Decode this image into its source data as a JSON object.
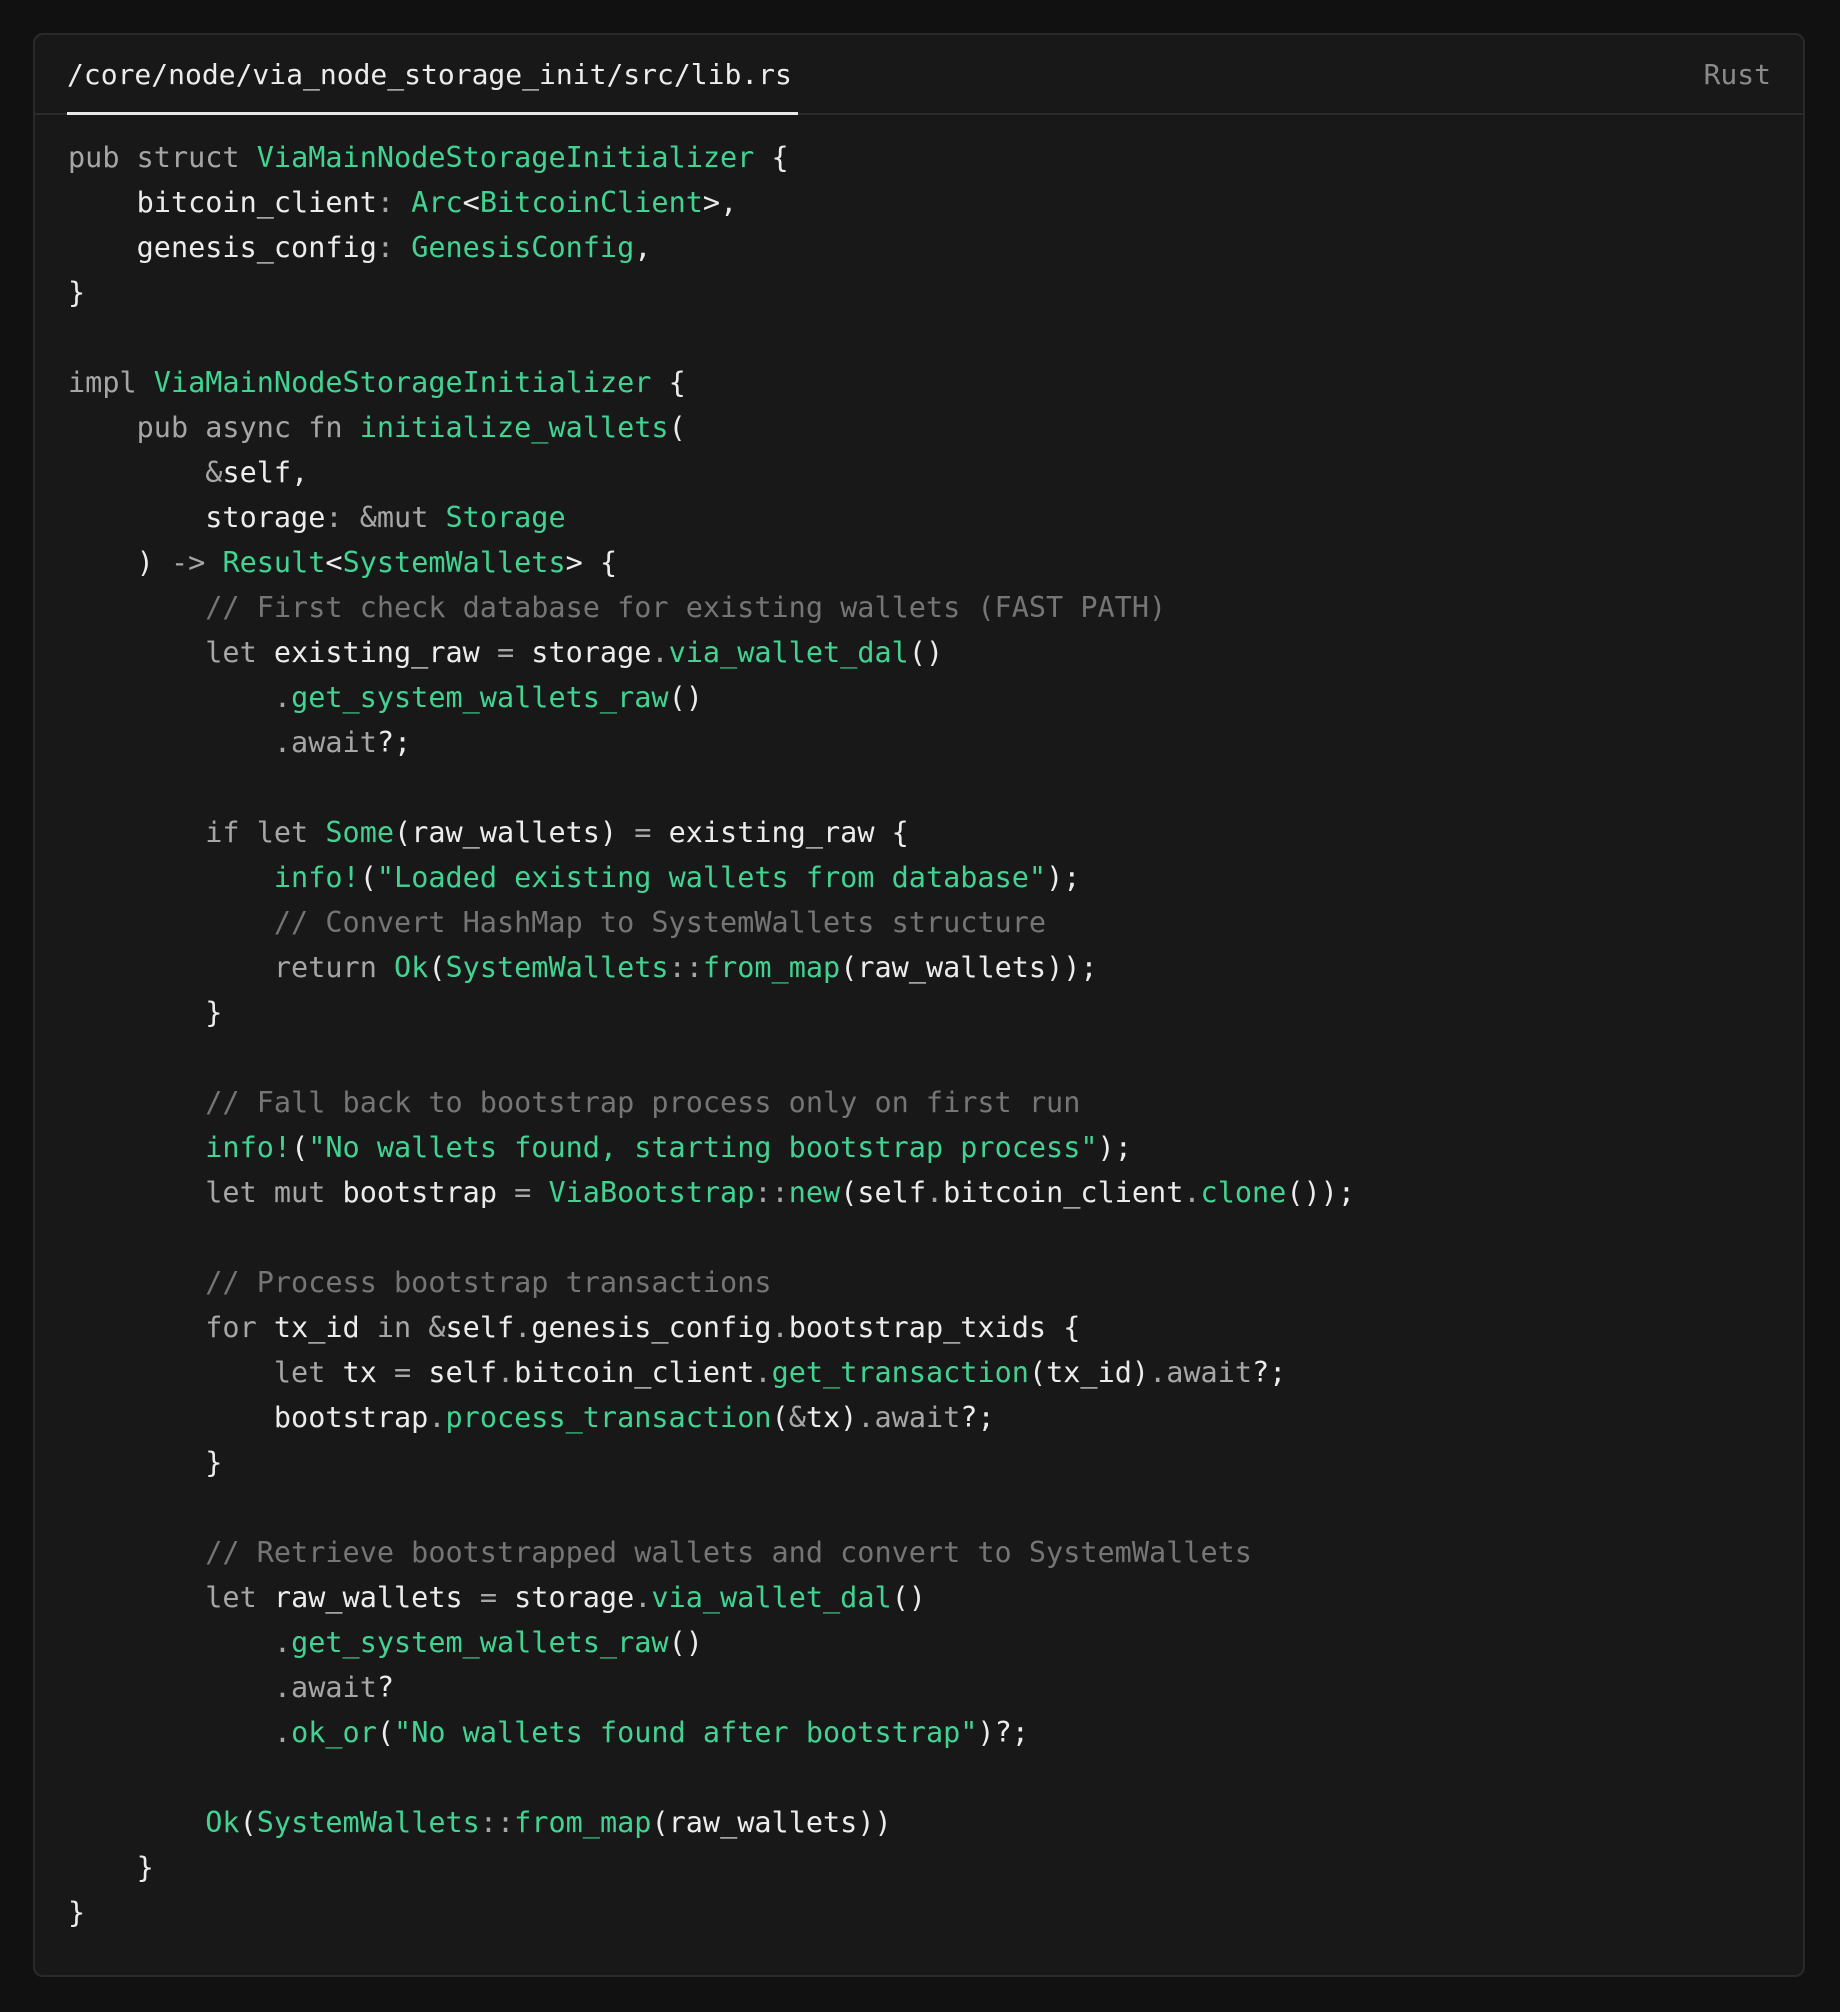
{
  "editor": {
    "file_path": "/core/node/via_node_storage_init/src/lib.rs",
    "language": "Rust"
  },
  "theme": {
    "background": "#111111",
    "panel": "#181818",
    "border": "#2a2a2a",
    "text": "#ececec",
    "keyword": "#a6a6a6",
    "accent_green": "#42d392",
    "comment": "#757575"
  },
  "code": {
    "lines": [
      [
        [
          "kw",
          "pub struct "
        ],
        [
          "ty",
          "ViaMainNodeStorageInitializer"
        ],
        [
          "id",
          " {"
        ]
      ],
      [
        [
          "id",
          "    bitcoin_client"
        ],
        [
          "pu",
          ": "
        ],
        [
          "ty",
          "Arc"
        ],
        [
          "id",
          "<"
        ],
        [
          "ty",
          "BitcoinClient"
        ],
        [
          "id",
          ">,"
        ]
      ],
      [
        [
          "id",
          "    genesis_config"
        ],
        [
          "pu",
          ": "
        ],
        [
          "ty",
          "GenesisConfig"
        ],
        [
          "id",
          ","
        ]
      ],
      [
        [
          "id",
          "}"
        ]
      ],
      [],
      [
        [
          "kw",
          "impl "
        ],
        [
          "ty",
          "ViaMainNodeStorageInitializer"
        ],
        [
          "id",
          " {"
        ]
      ],
      [
        [
          "kw",
          "    pub async fn "
        ],
        [
          "fn",
          "initialize_wallets"
        ],
        [
          "id",
          "("
        ]
      ],
      [
        [
          "kw",
          "        &"
        ],
        [
          "id",
          "self,"
        ]
      ],
      [
        [
          "id",
          "        storage"
        ],
        [
          "pu",
          ": "
        ],
        [
          "kw",
          "&mut "
        ],
        [
          "ty",
          "Storage"
        ]
      ],
      [
        [
          "id",
          "    ) "
        ],
        [
          "kw",
          "-> "
        ],
        [
          "ty",
          "Result"
        ],
        [
          "id",
          "<"
        ],
        [
          "ty",
          "SystemWallets"
        ],
        [
          "id",
          "> {"
        ]
      ],
      [
        [
          "cm",
          "        // First check database for existing wallets (FAST PATH)"
        ]
      ],
      [
        [
          "kw",
          "        let "
        ],
        [
          "id",
          "existing_raw "
        ],
        [
          "kw",
          "= "
        ],
        [
          "id",
          "storage"
        ],
        [
          "pu",
          "."
        ],
        [
          "fn",
          "via_wallet_dal"
        ],
        [
          "id",
          "()"
        ]
      ],
      [
        [
          "pu",
          "            ."
        ],
        [
          "fn",
          "get_system_wallets_raw"
        ],
        [
          "id",
          "()"
        ]
      ],
      [
        [
          "pu",
          "            .await"
        ],
        [
          "id",
          "?;"
        ]
      ],
      [],
      [
        [
          "kw",
          "        if let "
        ],
        [
          "ty",
          "Some"
        ],
        [
          "id",
          "(raw_wallets) "
        ],
        [
          "kw",
          "= "
        ],
        [
          "id",
          "existing_raw {"
        ]
      ],
      [
        [
          "fn",
          "            info!"
        ],
        [
          "id",
          "("
        ],
        [
          "st",
          "\"Loaded existing wallets from database\""
        ],
        [
          "id",
          ");"
        ]
      ],
      [
        [
          "cm",
          "            // Convert HashMap to SystemWallets structure"
        ]
      ],
      [
        [
          "kw",
          "            return "
        ],
        [
          "ty",
          "Ok"
        ],
        [
          "id",
          "("
        ],
        [
          "ty",
          "SystemWallets"
        ],
        [
          "pu",
          "::"
        ],
        [
          "fn",
          "from_map"
        ],
        [
          "id",
          "(raw_wallets));"
        ]
      ],
      [
        [
          "id",
          "        }"
        ]
      ],
      [],
      [
        [
          "cm",
          "        // Fall back to bootstrap process only on first run"
        ]
      ],
      [
        [
          "fn",
          "        info!"
        ],
        [
          "id",
          "("
        ],
        [
          "st",
          "\"No wallets found, starting bootstrap process\""
        ],
        [
          "id",
          ");"
        ]
      ],
      [
        [
          "kw",
          "        let mut "
        ],
        [
          "id",
          "bootstrap "
        ],
        [
          "kw",
          "= "
        ],
        [
          "ty",
          "ViaBootstrap"
        ],
        [
          "pu",
          "::"
        ],
        [
          "fn",
          "new"
        ],
        [
          "id",
          "(self"
        ],
        [
          "pu",
          "."
        ],
        [
          "id",
          "bitcoin_client"
        ],
        [
          "pu",
          "."
        ],
        [
          "fn",
          "clone"
        ],
        [
          "id",
          "());"
        ]
      ],
      [],
      [
        [
          "cm",
          "        // Process bootstrap transactions"
        ]
      ],
      [
        [
          "kw",
          "        for "
        ],
        [
          "id",
          "tx_id "
        ],
        [
          "kw",
          "in &"
        ],
        [
          "id",
          "self"
        ],
        [
          "pu",
          "."
        ],
        [
          "id",
          "genesis_config"
        ],
        [
          "pu",
          "."
        ],
        [
          "id",
          "bootstrap_txids {"
        ]
      ],
      [
        [
          "kw",
          "            let "
        ],
        [
          "id",
          "tx "
        ],
        [
          "kw",
          "= "
        ],
        [
          "id",
          "self"
        ],
        [
          "pu",
          "."
        ],
        [
          "id",
          "bitcoin_client"
        ],
        [
          "pu",
          "."
        ],
        [
          "fn",
          "get_transaction"
        ],
        [
          "id",
          "(tx_id)"
        ],
        [
          "pu",
          ".await"
        ],
        [
          "id",
          "?;"
        ]
      ],
      [
        [
          "id",
          "            bootstrap"
        ],
        [
          "pu",
          "."
        ],
        [
          "fn",
          "process_transaction"
        ],
        [
          "id",
          "("
        ],
        [
          "kw",
          "&"
        ],
        [
          "id",
          "tx)"
        ],
        [
          "pu",
          ".await"
        ],
        [
          "id",
          "?;"
        ]
      ],
      [
        [
          "id",
          "        }"
        ]
      ],
      [],
      [
        [
          "cm",
          "        // Retrieve bootstrapped wallets and convert to SystemWallets"
        ]
      ],
      [
        [
          "kw",
          "        let "
        ],
        [
          "id",
          "raw_wallets "
        ],
        [
          "kw",
          "= "
        ],
        [
          "id",
          "storage"
        ],
        [
          "pu",
          "."
        ],
        [
          "fn",
          "via_wallet_dal"
        ],
        [
          "id",
          "()"
        ]
      ],
      [
        [
          "pu",
          "            ."
        ],
        [
          "fn",
          "get_system_wallets_raw"
        ],
        [
          "id",
          "()"
        ]
      ],
      [
        [
          "pu",
          "            .await"
        ],
        [
          "id",
          "?"
        ]
      ],
      [
        [
          "pu",
          "            ."
        ],
        [
          "fn",
          "ok_or"
        ],
        [
          "id",
          "("
        ],
        [
          "st",
          "\"No wallets found after bootstrap\""
        ],
        [
          "id",
          ")?;"
        ]
      ],
      [],
      [
        [
          "ty",
          "        Ok"
        ],
        [
          "id",
          "("
        ],
        [
          "ty",
          "SystemWallets"
        ],
        [
          "pu",
          "::"
        ],
        [
          "fn",
          "from_map"
        ],
        [
          "id",
          "(raw_wallets))"
        ]
      ],
      [
        [
          "id",
          "    }"
        ]
      ],
      [
        [
          "id",
          "}"
        ]
      ]
    ]
  }
}
